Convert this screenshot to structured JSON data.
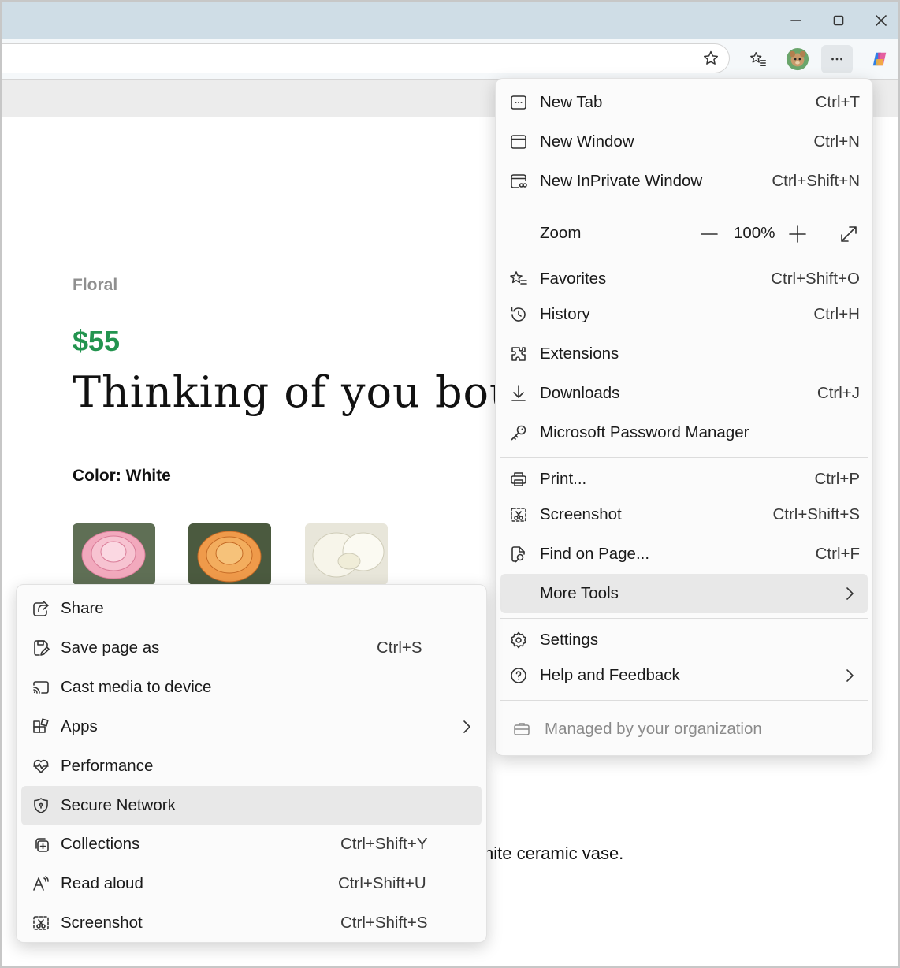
{
  "window": {
    "controls": {
      "minimize": "minimize-icon",
      "maximize": "maximize-icon",
      "close": "close-icon"
    }
  },
  "toolbar": {
    "icons": [
      "star-icon",
      "favorites-icon",
      "avatar",
      "more-icon",
      "copilot-icon"
    ]
  },
  "page": {
    "brand": "Floral",
    "price": "$55",
    "title": "Thinking of you bouq",
    "color_label": "Color: White",
    "description_fragment": "hite ceramic vase.",
    "swatches": [
      "pink",
      "orange",
      "white"
    ],
    "colors": {
      "price": "#23944f",
      "brand": "#8f8f8f"
    }
  },
  "main_menu": {
    "items": [
      {
        "label": "New Tab",
        "shortcut": "Ctrl+T",
        "icon": "new-tab-icon"
      },
      {
        "label": "New Window",
        "shortcut": "Ctrl+N",
        "icon": "new-window-icon"
      },
      {
        "label": "New InPrivate Window",
        "shortcut": "Ctrl+Shift+N",
        "icon": "inprivate-icon"
      }
    ],
    "zoom": {
      "label": "Zoom",
      "value": "100%",
      "minus": "—",
      "plus": "+"
    },
    "items2": [
      {
        "label": "Favorites",
        "shortcut": "Ctrl+Shift+O",
        "icon": "favorites-icon"
      },
      {
        "label": "History",
        "shortcut": "Ctrl+H",
        "icon": "history-icon"
      },
      {
        "label": "Extensions",
        "shortcut": "",
        "icon": "extensions-icon"
      },
      {
        "label": "Downloads",
        "shortcut": "Ctrl+J",
        "icon": "download-icon"
      },
      {
        "label": "Microsoft Password Manager",
        "shortcut": "",
        "icon": "key-icon"
      }
    ],
    "items3": [
      {
        "label": "Print...",
        "shortcut": "Ctrl+P",
        "icon": "print-icon"
      },
      {
        "label": "Screenshot",
        "shortcut": "Ctrl+Shift+S",
        "icon": "screenshot-icon"
      },
      {
        "label": "Find on Page...",
        "shortcut": "Ctrl+F",
        "icon": "find-icon"
      },
      {
        "label": "More Tools",
        "shortcut": "",
        "icon": ""
      }
    ],
    "items4": [
      {
        "label": "Settings",
        "shortcut": "",
        "icon": "settings-icon"
      },
      {
        "label": "Help and Feedback",
        "shortcut": "",
        "icon": "help-icon"
      }
    ],
    "managed": "Managed by your organization"
  },
  "sub_menu": {
    "items": [
      {
        "label": "Share",
        "shortcut": "",
        "icon": "share-icon"
      },
      {
        "label": "Save page as",
        "shortcut": "Ctrl+S",
        "icon": "save-icon"
      },
      {
        "label": "Cast media to device",
        "shortcut": "",
        "icon": "cast-icon"
      },
      {
        "label": "Apps",
        "shortcut": "",
        "icon": "apps-icon"
      },
      {
        "label": "Performance",
        "shortcut": "",
        "icon": "performance-icon"
      },
      {
        "label": "Secure Network",
        "shortcut": "",
        "icon": "shield-icon"
      },
      {
        "label": "Collections",
        "shortcut": "Ctrl+Shift+Y",
        "icon": "collections-icon"
      },
      {
        "label": "Read aloud",
        "shortcut": "Ctrl+Shift+U",
        "icon": "read-aloud-icon"
      },
      {
        "label": "Screenshot",
        "shortcut": "Ctrl+Shift+S",
        "icon": "screenshot-icon"
      }
    ]
  }
}
